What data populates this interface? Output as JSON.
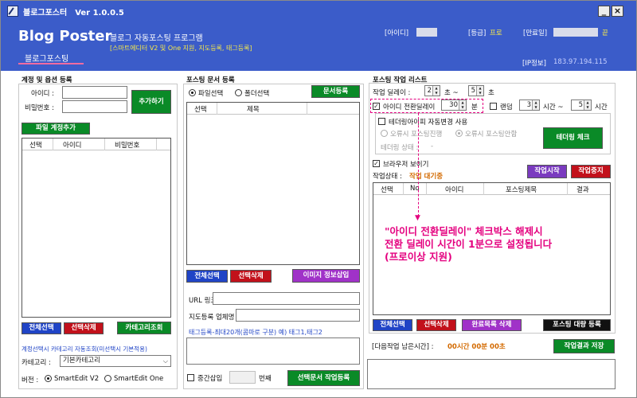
{
  "window": {
    "title": "블로그포스터",
    "version": "Ver 1.0.0.5",
    "min_label": "_",
    "close_label": "×"
  },
  "header": {
    "logo": "Blog Poster",
    "subtitle": "블로그 자동포스팅 프로그램",
    "subline": "[스마트에디터 V2 및 One 지원, 지도등록, 태그등록]",
    "id_label": "[아이디]",
    "grade_label": "[등급]",
    "grade_value": "프로",
    "expire_label": "[만료일]",
    "expire_suffix": "끝",
    "ip_label": "[IP정보]",
    "ip_value": "183.97.194.115",
    "main_tab": "블로그포스팅"
  },
  "account": {
    "group_title": "계정 및 옵션 등록",
    "id_label": "아이디 :",
    "pw_label": "비밀번호 :",
    "add_button": "추가하기",
    "file_add_button": "파일 계정추가",
    "columns": [
      "선택",
      "아이디",
      "비밀번호"
    ],
    "select_all": "전체선택",
    "delete_selected": "선택삭제",
    "category_lookup": "카테고리조회",
    "category_note": "계정선택시 카테고리 자동조회(미선택시 기본적용)",
    "category_label": "카테고리 :",
    "category_value": "기본카테고리",
    "version_label": "버전 :",
    "version_v2": "SmartEdit V2",
    "version_one": "SmartEdit One"
  },
  "docs": {
    "group_title": "포스팅 문서 등록",
    "file_select": "파일선택",
    "folder_select": "폴더선택",
    "doc_register": "문서등록",
    "columns": [
      "선택",
      "제목"
    ],
    "select_all": "전체선택",
    "delete_selected": "선택삭제",
    "image_info_insert": "이미지 정보삽입",
    "url_label": "URL 링크",
    "map_label": "지도등록 업체명",
    "tag_note": "태그등록-최대20개(콤마로 구분) 예) 태그1,태그2",
    "mid_insert_label": "중간삽입",
    "mid_insert_suffix": "번째",
    "selected_doc_register": "선택문서 작업등록"
  },
  "posting": {
    "group_title": "포스팅 작업 리스트",
    "delay_label": "작업 딜레이 :",
    "delay_from": "2",
    "delay_mid": "초 ~",
    "delay_to": "5",
    "delay_unit": "초",
    "id_switch_label": "아이디 전환딜레이",
    "id_switch_value": "30",
    "id_switch_unit": "분",
    "random_label": "랜덤",
    "random_from": "3",
    "random_mid": "시간 ~",
    "random_to": "5",
    "random_unit": "시간",
    "tether_label": "테더링아이피 자동변경 사용",
    "error_continue": "오류시 포스팅진행",
    "error_stop": "오류시 포스팅안함",
    "tether_check": "테더링 체크",
    "tether_status_label": "테더링 상태 :",
    "tether_status_value": "-",
    "browser_show": "브라우저 보이기",
    "status_label": "작업상태 :",
    "status_value": "작업 대기중",
    "start_button": "작업시작",
    "stop_button": "작업중지",
    "columns": [
      "선택",
      "No",
      "아이디",
      "포스팅제목",
      "결과"
    ],
    "select_all": "전체선택",
    "delete_selected": "선택삭제",
    "done_delete": "완료목록 삭제",
    "bulk_register": "포스팅 대량 등록",
    "remaining_label": "[다음작업 남은시간] :",
    "remaining_value": "00시간 00분 00초",
    "save_results": "작업결과 저장"
  },
  "annotation": {
    "line1": "\"아이디 전환딜레이\" 체크박스 해제시",
    "line2": "전환 딜레이 시간이 1분으로 설정됩니다",
    "line3": "(프로이상 지원)"
  }
}
